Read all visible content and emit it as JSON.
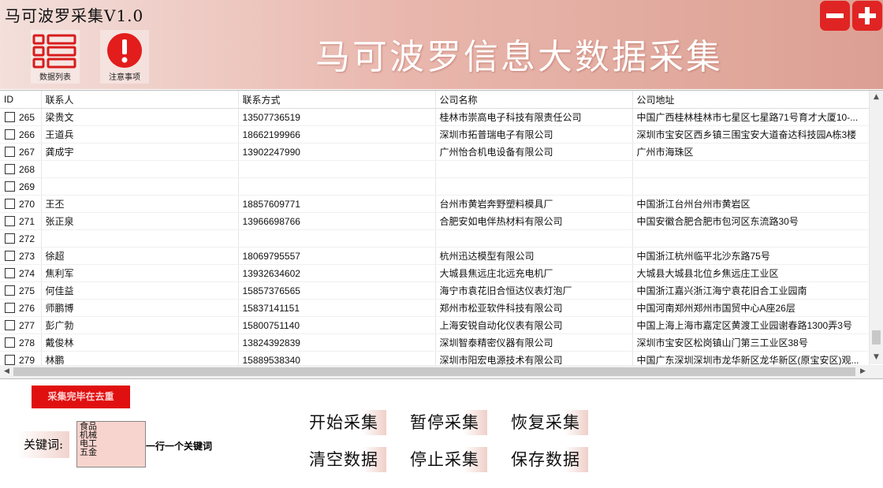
{
  "header": {
    "app_title": "马可波罗采集V1.0",
    "banner": "马可波罗信息大数据采集",
    "data_list_label": "数据列表",
    "notice_label": "注意事项"
  },
  "table": {
    "columns": [
      "ID",
      "联系人",
      "联系方式",
      "公司名称",
      "公司地址"
    ],
    "rows": [
      [
        "265",
        "梁贵文",
        "13507736519",
        "桂林市崇高电子科技有限责任公司",
        "中国广西桂林桂林市七星区七星路71号育才大厦10-..."
      ],
      [
        "266",
        "王道兵",
        "18662199966",
        "深圳市拓普瑞电子有限公司",
        "深圳市宝安区西乡镇三围宝安大道奋达科技园A栋3楼"
      ],
      [
        "267",
        "龚成宇",
        "13902247990",
        "广州怡合机电设备有限公司",
        "广州市海珠区"
      ],
      [
        "268",
        "",
        "",
        "",
        ""
      ],
      [
        "269",
        "",
        "",
        "",
        ""
      ],
      [
        "270",
        "王丕",
        "18857609771",
        "台州市黄岩奔野塑料模具厂",
        "中国浙江台州台州市黄岩区"
      ],
      [
        "271",
        "张正泉",
        "13966698766",
        "合肥安如电伴热材料有限公司",
        "中国安徽合肥合肥市包河区东流路30号"
      ],
      [
        "272",
        "",
        "",
        "",
        ""
      ],
      [
        "273",
        "徐超",
        "18069795557",
        "杭州迅达模型有限公司",
        "中国浙江杭州临平北沙东路75号"
      ],
      [
        "274",
        "焦利军",
        "13932634602",
        "大城县焦远庄北远充电机厂",
        "大城县大城县北位乡焦远庄工业区"
      ],
      [
        "275",
        "何佳益",
        "15857376565",
        "海宁市袁花旧合恒达仪表灯泡厂",
        "中国浙江嘉兴浙江海宁袁花旧合工业园南"
      ],
      [
        "276",
        "师鹏博",
        "15837141151",
        "郑州市松亚软件科技有限公司",
        "中国河南郑州郑州市国贸中心A座26层"
      ],
      [
        "277",
        "彭广勃",
        "15800751140",
        "上海安锐自动化仪表有限公司",
        "中国上海上海市嘉定区黄渡工业园谢春路1300弄3号"
      ],
      [
        "278",
        "戴俊林",
        "13824392839",
        "深圳智泰精密仪器有限公司",
        "深圳市宝安区松岗镇山门第三工业区38号"
      ],
      [
        "279",
        "林鹏",
        "15889538340",
        "深圳市阳宏电源技术有限公司",
        "中国广东深圳深圳市龙华新区龙华新区(原宝安区)观..."
      ]
    ]
  },
  "status": {
    "badge": "采集完毕在去重"
  },
  "keywords": {
    "label": "关键词:",
    "items": [
      "食品",
      "机械",
      "电工",
      "五金"
    ],
    "hint": "一行一个关键词"
  },
  "actions": {
    "start": "开始采集",
    "pause": "暂停采集",
    "resume": "恢复采集",
    "clear": "清空数据",
    "stop": "停止采集",
    "save": "保存数据"
  },
  "colors": {
    "accent_red": "#e01010",
    "header_pink": "#e9b7ad"
  }
}
